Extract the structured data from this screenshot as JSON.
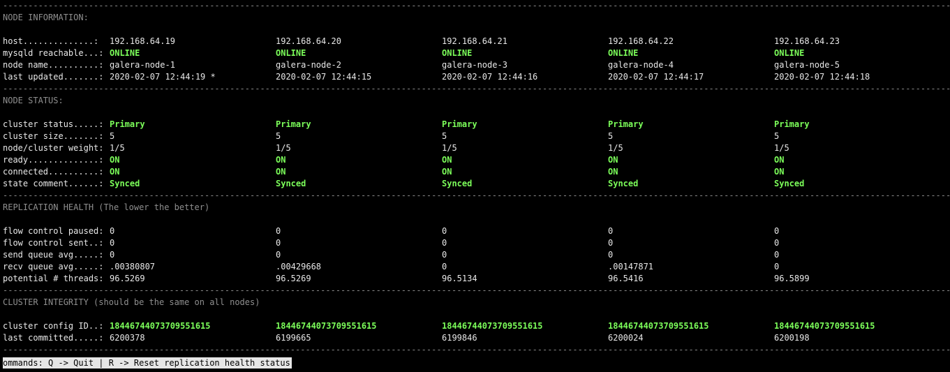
{
  "separator": "----------------------------------------------------------------------------------------------------------------------------------------------------------------------------------------------------------------------",
  "node_information": {
    "title": "NODE INFORMATION:",
    "rows": [
      {
        "label": "host..............:",
        "values": [
          "192.168.64.19",
          "192.168.64.20",
          "192.168.64.21",
          "192.168.64.22",
          "192.168.64.23"
        ],
        "highlight": false
      },
      {
        "label": "mysqld reachable...:",
        "values": [
          "ONLINE",
          "ONLINE",
          "ONLINE",
          "ONLINE",
          "ONLINE"
        ],
        "highlight": true
      },
      {
        "label": "node name..........:",
        "values": [
          "galera-node-1",
          "galera-node-2",
          "galera-node-3",
          "galera-node-4",
          "galera-node-5"
        ],
        "highlight": false
      },
      {
        "label": "last updated.......:",
        "values": [
          "2020-02-07 12:44:19 *",
          "2020-02-07 12:44:15",
          "2020-02-07 12:44:16",
          "2020-02-07 12:44:17",
          "2020-02-07 12:44:18"
        ],
        "highlight": false
      }
    ]
  },
  "node_status": {
    "title": "NODE STATUS:",
    "rows": [
      {
        "label": "cluster status.....:",
        "values": [
          "Primary",
          "Primary",
          "Primary",
          "Primary",
          "Primary"
        ],
        "highlight": true
      },
      {
        "label": "cluster size.......:",
        "values": [
          "5",
          "5",
          "5",
          "5",
          "5"
        ],
        "highlight": false
      },
      {
        "label": "node/cluster weight:",
        "values": [
          "1/5",
          "1/5",
          "1/5",
          "1/5",
          "1/5"
        ],
        "highlight": false
      },
      {
        "label": "ready..............:",
        "values": [
          "ON",
          "ON",
          "ON",
          "ON",
          "ON"
        ],
        "highlight": true
      },
      {
        "label": "connected..........:",
        "values": [
          "ON",
          "ON",
          "ON",
          "ON",
          "ON"
        ],
        "highlight": true
      },
      {
        "label": "state comment......:",
        "values": [
          "Synced",
          "Synced",
          "Synced",
          "Synced",
          "Synced"
        ],
        "highlight": true
      }
    ]
  },
  "replication_health": {
    "title": "REPLICATION HEALTH (The lower the better)",
    "rows": [
      {
        "label": "flow control paused:",
        "values": [
          "0",
          "0",
          "0",
          "0",
          "0"
        ],
        "highlight": false
      },
      {
        "label": "flow control sent..:",
        "values": [
          "0",
          "0",
          "0",
          "0",
          "0"
        ],
        "highlight": false
      },
      {
        "label": "send queue avg.....:",
        "values": [
          "0",
          "0",
          "0",
          "0",
          "0"
        ],
        "highlight": false
      },
      {
        "label": "recv queue avg.....:",
        "values": [
          ".00380807",
          ".00429668",
          "0",
          ".00147871",
          "0"
        ],
        "highlight": false
      },
      {
        "label": "potential # threads:",
        "values": [
          "96.5269",
          "96.5269",
          "96.5134",
          "96.5416",
          "96.5899"
        ],
        "highlight": false
      }
    ]
  },
  "cluster_integrity": {
    "title": "CLUSTER INTEGRITY (should be the same on all nodes)",
    "rows": [
      {
        "label": "cluster config ID..:",
        "values": [
          "18446744073709551615",
          "18446744073709551615",
          "18446744073709551615",
          "18446744073709551615",
          "18446744073709551615"
        ],
        "highlight": true
      },
      {
        "label": "last committed.....:",
        "values": [
          "6200378",
          "6199665",
          "6199846",
          "6200024",
          "6200198"
        ],
        "highlight": false
      }
    ]
  },
  "status_bar": {
    "text": "ommands: Q -> Quit | R -> Reset replication health status"
  },
  "colors": {
    "background": "#000000",
    "text": "#e8e8e8",
    "highlight": "#7cff5a",
    "section_title": "#8f8f8f",
    "status_bar_bg": "#e6e6e6"
  }
}
